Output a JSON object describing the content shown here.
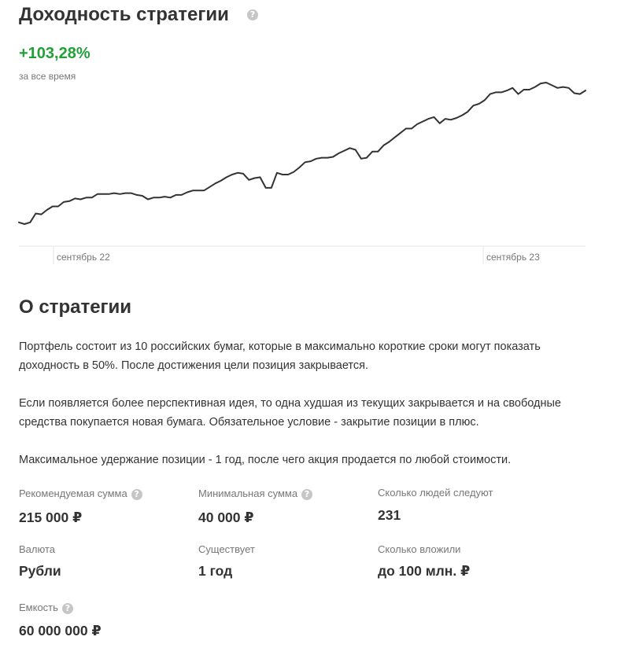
{
  "yield_section": {
    "title": "Доходность стратегии",
    "help_icon": "question-circle-icon",
    "value": "+103,28%",
    "value_color": "#21a038",
    "caption": "за все время"
  },
  "chart_data": {
    "type": "line",
    "x_tick_labels": [
      "сентябрь 22",
      "сентябрь 23"
    ],
    "line_color": "#333333",
    "grid": false,
    "values": [
      0.8,
      0.0,
      0.8,
      4.8,
      4.4,
      6.4,
      8.0,
      8.0,
      10.0,
      10.4,
      11.6,
      11.2,
      12.0,
      12.0,
      13.6,
      13.6,
      13.6,
      14.0,
      13.6,
      14.0,
      14.0,
      13.2,
      12.8,
      11.2,
      12.0,
      12.0,
      12.4,
      12.0,
      13.2,
      13.2,
      14.4,
      15.2,
      15.2,
      15.2,
      16.8,
      18.4,
      19.6,
      21.2,
      22.4,
      23.2,
      22.8,
      20.0,
      20.8,
      21.2,
      16.4,
      16.4,
      23.2,
      22.4,
      22.4,
      23.6,
      25.6,
      28.0,
      28.4,
      29.6,
      30.0,
      30.0,
      30.4,
      32.0,
      33.2,
      34.4,
      33.6,
      29.6,
      30.0,
      32.8,
      32.8,
      35.6,
      37.2,
      39.2,
      41.2,
      43.2,
      43.2,
      45.2,
      46.4,
      47.6,
      48.4,
      45.6,
      47.6,
      47.2,
      48.0,
      49.2,
      50.8,
      53.6,
      54.4,
      56.0,
      58.8,
      59.6,
      59.6,
      60.4,
      61.6,
      58.8,
      60.8,
      60.8,
      62.0,
      63.6,
      64.0,
      62.8,
      61.6,
      62.0,
      61.6,
      59.2,
      58.8,
      60.4
    ]
  },
  "about_section": {
    "title": "О стратегии",
    "paragraphs": [
      "Портфель состоит из 10 российских бумаг, которые в максимально короткие сроки могут показать доходность в 50%. После достижения цели позиция закрывается.",
      "Если появляется более перспективная идея, то одна худшая из текущих закрывается и на свободные средства покупается новая бумага. Обязательное условие - закрытие позиции в плюс.",
      "Максимальное удержание позиции - 1 год, после чего акция продается по любой стоимости."
    ]
  },
  "stats": [
    {
      "label": "Рекомендуемая сумма",
      "value": "215 000 ₽",
      "has_help_icon": true
    },
    {
      "label": "Минимальная сумма",
      "value": "40 000 ₽",
      "has_help_icon": true
    },
    {
      "label": "Сколько людей следуют",
      "value": "231",
      "has_help_icon": false
    },
    {
      "label": "Валюта",
      "value": "Рубли",
      "has_help_icon": false
    },
    {
      "label": "Существует",
      "value": "1 год",
      "has_help_icon": false
    },
    {
      "label": "Сколько вложили",
      "value": "до 100 млн. ₽",
      "has_help_icon": false
    },
    {
      "label": "Емкость",
      "value": "60 000 000 ₽",
      "has_help_icon": true
    }
  ]
}
